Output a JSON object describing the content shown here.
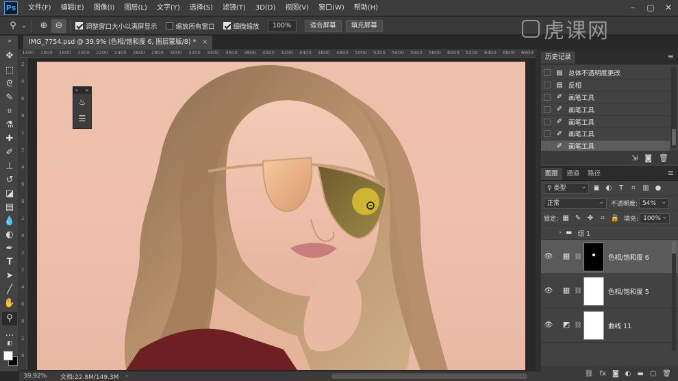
{
  "app": {
    "logo": "Ps"
  },
  "menu": [
    "文件(F)",
    "编辑(E)",
    "图像(I)",
    "图层(L)",
    "文字(Y)",
    "选择(S)",
    "滤镜(T)",
    "3D(D)",
    "视图(V)",
    "窗口(W)",
    "帮助(H)"
  ],
  "watermark": "虎课网",
  "options": {
    "chk_resize": "调整窗口大小以满屏显示",
    "chk_all_windows": "缩放所有窗口",
    "chk_scrubby": "细微缩放",
    "zoom_value": "100%",
    "fit_screen": "适合屏幕",
    "fill_screen": "填充屏幕"
  },
  "document": {
    "tab_title": "IMG_7754.psd @ 39.9% (色相/饱和度 6, 图层蒙版/8) *"
  },
  "rulers": {
    "top": [
      "1400",
      "1600",
      "1800",
      "2000",
      "2200",
      "2400",
      "2600",
      "2800",
      "3000",
      "3200",
      "3400",
      "3600",
      "3800",
      "4000",
      "4200",
      "4400",
      "4600",
      "4800",
      "5000",
      "5200",
      "5400",
      "5600",
      "5800",
      "6000",
      "6200",
      "6400",
      "6600",
      "6800"
    ],
    "left": [
      "2",
      "4",
      "6",
      "8",
      "1",
      "2",
      "4",
      "6",
      "8",
      "2",
      "0",
      "2",
      "2",
      "4",
      "6",
      "8",
      "2",
      "6"
    ]
  },
  "status": {
    "zoom": "39.92%",
    "doc": "文档:22.8M/149.3M",
    "arrow": "›"
  },
  "history": {
    "tabs": [
      "历史记录"
    ],
    "items": [
      {
        "label": "总体不透明度更改",
        "icon": "doc-icon"
      },
      {
        "label": "反相",
        "icon": "doc-icon"
      },
      {
        "label": "画笔工具",
        "icon": "brush-icon"
      },
      {
        "label": "画笔工具",
        "icon": "brush-icon"
      },
      {
        "label": "画笔工具",
        "icon": "brush-icon"
      },
      {
        "label": "画笔工具",
        "icon": "brush-icon"
      },
      {
        "label": "画笔工具",
        "icon": "brush-icon"
      }
    ]
  },
  "layers": {
    "tabs": [
      "图层",
      "通道",
      "路径"
    ],
    "filter_kind": "类型",
    "blend_mode": "正常",
    "opacity_label": "不透明度:",
    "opacity_value": "54%",
    "lock_label": "锁定:",
    "fill_label": "填充:",
    "fill_value": "100%",
    "group_name": "组 1",
    "items": [
      {
        "name": "色相/饱和度 6",
        "mask": "black",
        "selected": true
      },
      {
        "name": "色相/饱和度 5",
        "mask": "white",
        "selected": false
      },
      {
        "name": "曲线 11",
        "mask": "white",
        "selected": false
      }
    ]
  },
  "colors": {
    "accent": "#31a8ff",
    "canvas_bg": "#ecc0aa",
    "lens_tint": "#d7be2e"
  }
}
